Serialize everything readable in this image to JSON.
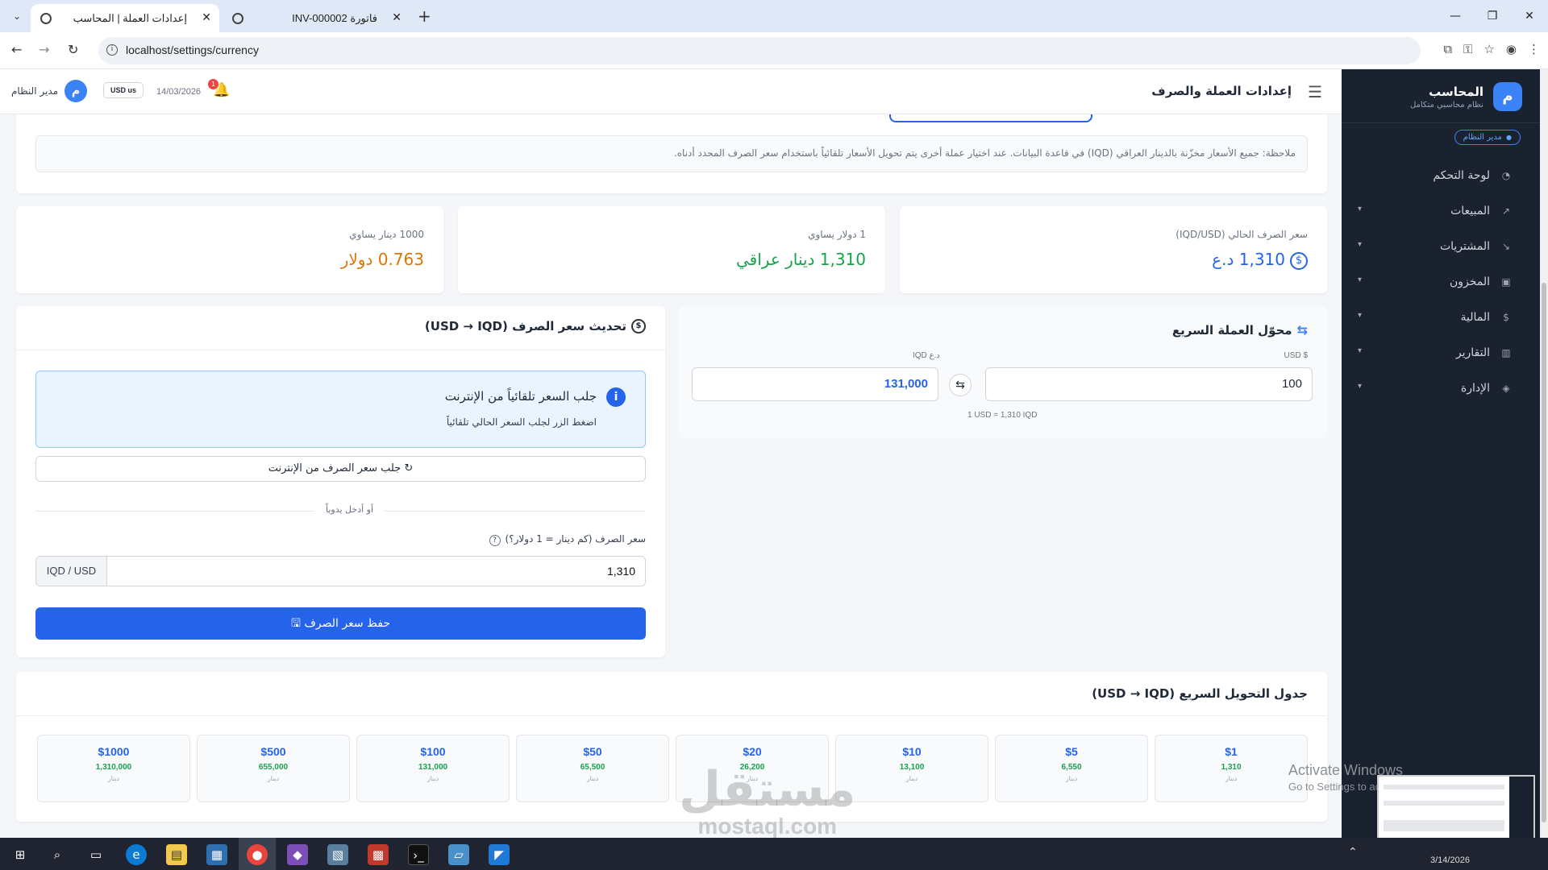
{
  "browser": {
    "tabs": [
      {
        "title": "إعدادات العملة | المحاسب",
        "active": true
      },
      {
        "title": "فاتورة INV-000002",
        "active": false
      }
    ],
    "new_tab": "+",
    "url": "localhost/settings/currency"
  },
  "sidebar": {
    "brand_logo": "م",
    "brand_name": "المحاسب",
    "brand_sub": "نظام محاسبي متكامل",
    "role": "مدير النظام",
    "items": [
      {
        "label": "لوحة التحكم",
        "icon": "gauge-icon",
        "glyph": "◔",
        "has_children": false
      },
      {
        "label": "المبيعات",
        "icon": "trend-up-icon",
        "glyph": "↗",
        "has_children": true
      },
      {
        "label": "المشتريات",
        "icon": "trend-down-icon",
        "glyph": "↘",
        "has_children": true
      },
      {
        "label": "المخزون",
        "icon": "box-icon",
        "glyph": "▣",
        "has_children": true
      },
      {
        "label": "المالية",
        "icon": "dollar-circle-icon",
        "glyph": "$",
        "has_children": true
      },
      {
        "label": "التقارير",
        "icon": "bar-chart-icon",
        "glyph": "▥",
        "has_children": true
      },
      {
        "label": "الإدارة",
        "icon": "shield-icon",
        "glyph": "◈",
        "has_children": true
      }
    ]
  },
  "header": {
    "title": "إعدادات العملة والصرف",
    "user_name": "مدير النظام",
    "avatar": "م",
    "currency_chip": "USD us",
    "date": "14/03/2026",
    "notification_count": "1"
  },
  "note": {
    "text": "ملاحظة: جميع الأسعار مخزّنة بالدينار العراقي (IQD) في قاعدة البيانات. عند اختيار عملة أخرى يتم تحويل الأسعار تلقائياً باستخدام سعر الصرف المحدد أدناه."
  },
  "stats": [
    {
      "label": "سعر الصرف الحالي (IQD/USD)",
      "value": "1,310 د.ع",
      "color": "#2563eb",
      "icon": "dollar-circle-icon"
    },
    {
      "label": "1 دولار يساوي",
      "value": "1,310 دينار عراقي",
      "color": "#16a34a"
    },
    {
      "label": "1000 دينار يساوي",
      "value": "0.763 دولار",
      "color": "#d97706"
    }
  ],
  "update": {
    "title": "تحديث سعر الصرف (USD → IQD)",
    "info_title": "جلب السعر تلقائياً من الإنترنت",
    "info_sub": "اضغط الزر لجلب السعر الحالي تلقائياً",
    "fetch_label": "جلب سعر الصرف من الإنترنت",
    "or_text": "أو أدخل يدوياً",
    "rate_label": "سعر الصرف (كم دينار = 1 دولار؟)",
    "rate_value": "1,310",
    "rate_addon": "IQD / USD",
    "save_label": "حفظ سعر الصرف"
  },
  "converter": {
    "title": "محوّل العملة السريع",
    "usd_label": "USD $",
    "usd_value": "100",
    "iqd_label": "IQD د.ع",
    "iqd_value": "131,000",
    "rate_text": "1 USD = 1,310 IQD"
  },
  "quick_table": {
    "title": "جدول التحويل السريع (USD → IQD)",
    "unit": "دينار",
    "tiles": [
      {
        "usd": "$1",
        "iqd": "1,310"
      },
      {
        "usd": "$5",
        "iqd": "6,550"
      },
      {
        "usd": "$10",
        "iqd": "13,100"
      },
      {
        "usd": "$20",
        "iqd": "26,200"
      },
      {
        "usd": "$50",
        "iqd": "65,500"
      },
      {
        "usd": "$100",
        "iqd": "131,000"
      },
      {
        "usd": "$500",
        "iqd": "655,000"
      },
      {
        "usd": "$1000",
        "iqd": "1,310,000"
      }
    ]
  },
  "overlay": {
    "activate_title": "Activate Windows",
    "activate_sub": "Go to Settings to activate Windows.",
    "watermark_ar": "مستقل",
    "watermark_en": "mostaql.com"
  },
  "taskbar": {
    "date": "3/14/2026"
  },
  "colors": {
    "primary": "#2563eb",
    "sidebar_bg": "#1a2230",
    "success": "#16a34a",
    "warning": "#d97706"
  }
}
